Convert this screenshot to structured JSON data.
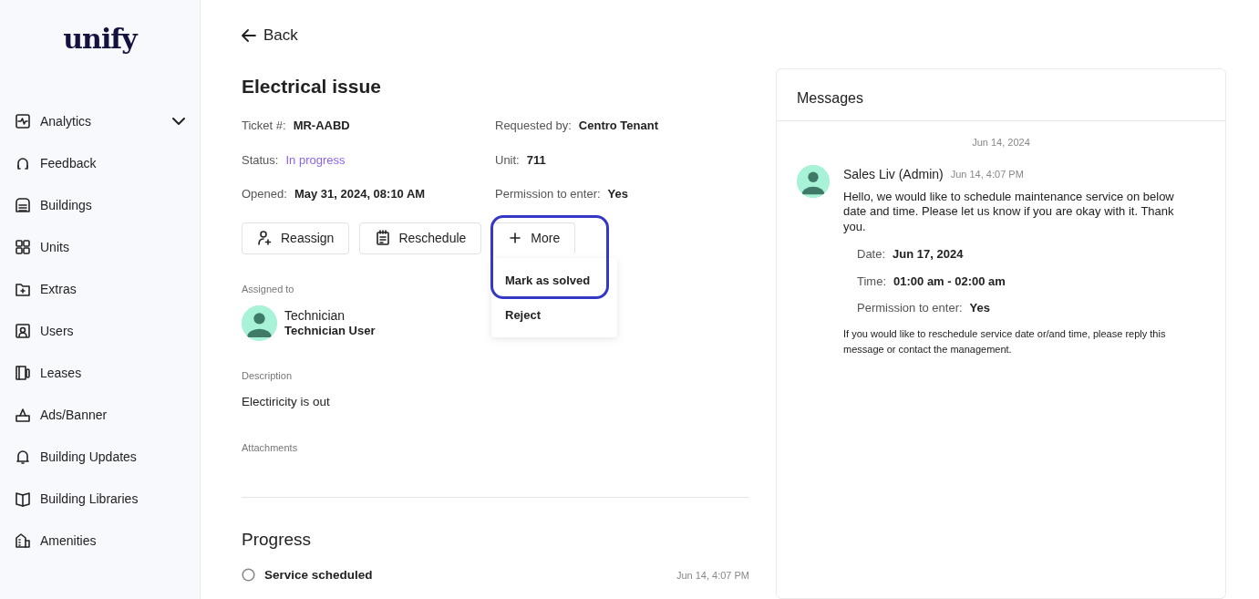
{
  "sidebar": {
    "logo": "unify",
    "groups": [
      [
        {
          "label": "Analytics",
          "expanded": false
        },
        {
          "label": "Feedback"
        }
      ],
      [
        {
          "label": "Buildings"
        },
        {
          "label": "Units"
        },
        {
          "label": "Extras"
        },
        {
          "label": "Users"
        },
        {
          "label": "Leases"
        }
      ],
      [
        {
          "label": "Ads/Banner"
        },
        {
          "label": "Building Updates"
        },
        {
          "label": "Building Libraries"
        }
      ],
      [
        {
          "label": "Amenities"
        }
      ]
    ]
  },
  "back": "Back",
  "title": "Electrical issue",
  "details": [
    {
      "label": "Ticket #:",
      "value": "MR-AABD",
      "kind": "plain"
    },
    {
      "label": "Requested by:",
      "value": "Centro Tenant",
      "kind": "plain"
    },
    {
      "label": "Status:",
      "value": "In progress",
      "kind": "status"
    },
    {
      "label": "Unit:",
      "value": "711",
      "kind": "plain"
    },
    {
      "label": "Opened:",
      "value": "May 31, 2024, 08:10 AM",
      "kind": "plain"
    },
    {
      "label": "Permission to enter:",
      "value": "Yes",
      "kind": "plain"
    }
  ],
  "actions": [
    {
      "label": "Reassign"
    },
    {
      "label": "Reschedule"
    },
    {
      "label": "More",
      "expanded": true
    }
  ],
  "more_menu": [
    {
      "label": "Mark as solved",
      "highlighted": true
    },
    {
      "label": "Reject",
      "highlighted": false
    }
  ],
  "assigned": {
    "heading": "Assigned to",
    "role": "Technician",
    "name": "Technician User"
  },
  "description": {
    "heading": "Description",
    "text": "Electiricity is out"
  },
  "attachments": {
    "heading": "Attachments"
  },
  "progress": {
    "heading": "Progress",
    "items": [
      {
        "label": "Service scheduled",
        "time": "Jun 14, 4:07 PM",
        "done": false
      }
    ]
  },
  "messages": {
    "title": "Messages",
    "date": "Jun 14, 2024",
    "items": [
      {
        "sender": "Sales Liv (Admin)",
        "time": "Jun 14, 4:07 PM",
        "text": "Hello, we would like to schedule maintenance service on below date and time. Please let us know if you are okay with it. Thank you.",
        "fields": [
          {
            "label": "Date:",
            "value": "Jun 17, 2024"
          },
          {
            "label": "Time:",
            "value": "01:00 am - 02:00 am"
          },
          {
            "label": "Permission to enter:",
            "value": "Yes"
          }
        ],
        "note": "If you would like to reschedule service date or/and time, please reply this message or contact the management."
      }
    ]
  }
}
